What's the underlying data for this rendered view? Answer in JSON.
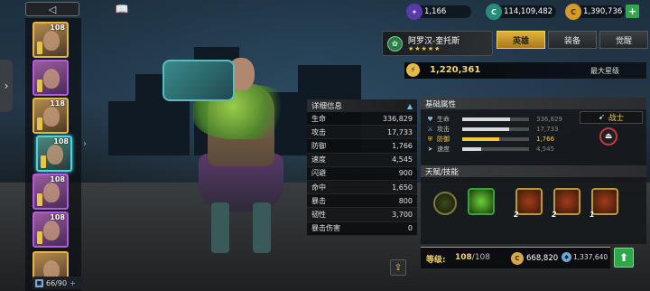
{
  "resources": {
    "energy": {
      "value": "1,166",
      "icon": "energy-orb-icon"
    },
    "currency": {
      "value": "114,109,482",
      "icon": "credits-icon",
      "glyph": "C"
    },
    "gold": {
      "value": "1,390,736",
      "icon": "gold-coin-icon",
      "glyph": "C"
    },
    "add": "+"
  },
  "nav": {
    "back": "◁",
    "book": "📖",
    "side_arrow": "›"
  },
  "hero": {
    "name": "阿罗汉-奎托斯",
    "stars": "★★★★★",
    "power": "1,220,361",
    "max_star_label": "最大星级"
  },
  "tabs": [
    "英雄",
    "装备",
    "觉醒"
  ],
  "detail": {
    "title": "详细信息",
    "rows": [
      {
        "k": "生命",
        "v": "336,829"
      },
      {
        "k": "攻击",
        "v": "17,733"
      },
      {
        "k": "防御",
        "v": "1,766"
      },
      {
        "k": "速度",
        "v": "4,545"
      },
      {
        "k": "闪避",
        "v": "900"
      },
      {
        "k": "命中",
        "v": "1,650"
      },
      {
        "k": "暴击",
        "v": "800"
      },
      {
        "k": "韧性",
        "v": "3,700"
      },
      {
        "k": "暴击伤害",
        "v": "0"
      }
    ]
  },
  "base_attrs": {
    "title": "基础属性",
    "role": "战士",
    "rows": [
      {
        "k": "生命",
        "v": "336,829",
        "level": 0.72,
        "icon": "heart-icon"
      },
      {
        "k": "攻击",
        "v": "17,733",
        "level": 0.7,
        "icon": "sword-icon"
      },
      {
        "k": "防御",
        "v": "1,766",
        "level": 0.55,
        "icon": "shield-icon"
      },
      {
        "k": "速度",
        "v": "4,545",
        "level": 0.28,
        "icon": "speed-icon"
      }
    ]
  },
  "skills": {
    "title": "天赋/技能",
    "counts": [
      "2",
      "2",
      "1"
    ]
  },
  "footer": {
    "level_label": "等级:",
    "level": "108",
    "level_max": "/108",
    "gold_cost": "668,820",
    "other_cost": "1,337,640",
    "level_up": "⬆"
  },
  "roster": {
    "count": "66/90",
    "levels": [
      "108",
      "",
      "118",
      "108",
      "108",
      "108"
    ]
  }
}
